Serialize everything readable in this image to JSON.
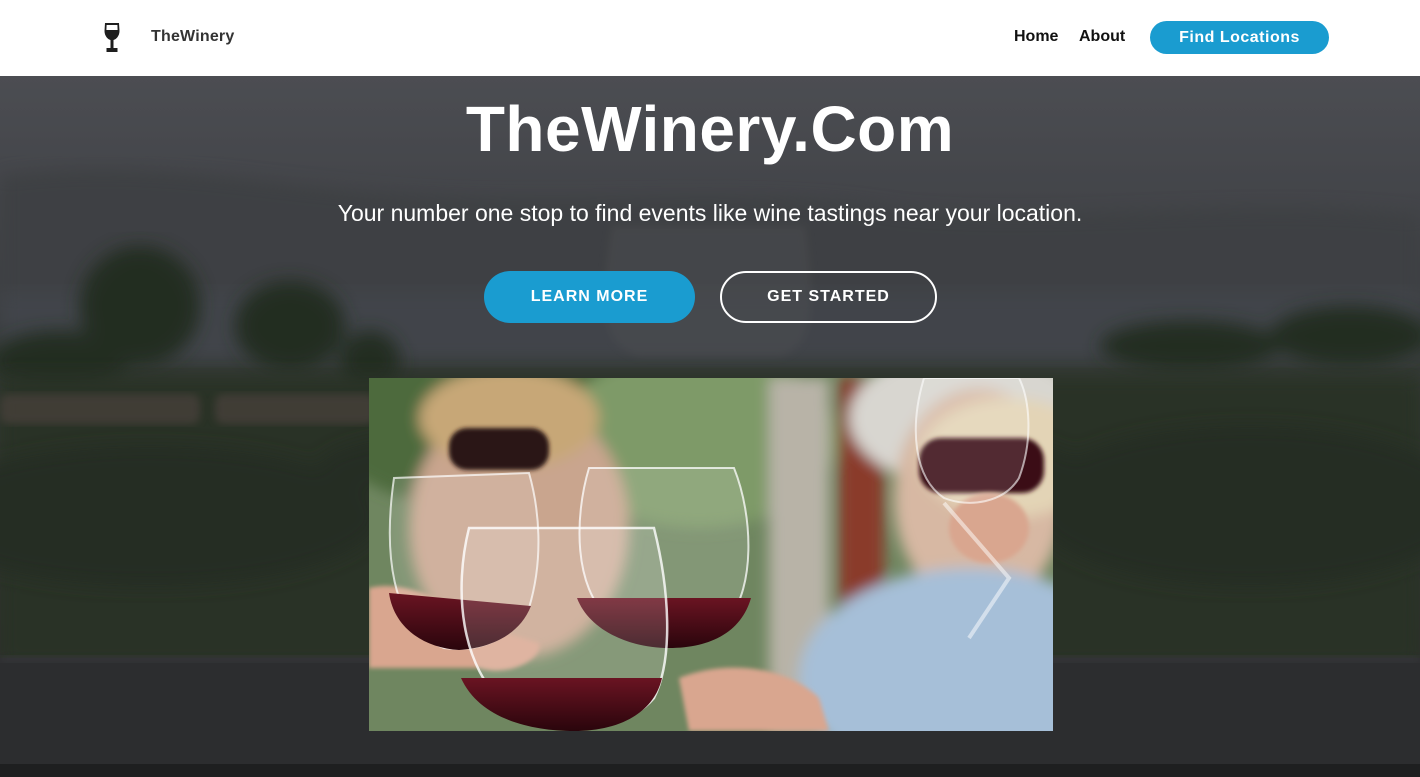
{
  "navbar": {
    "brand": "TheWinery",
    "brand_icon": "wine-glass-icon",
    "links": [
      "Home",
      "About"
    ],
    "cta": "Find Locations"
  },
  "hero": {
    "title": "TheWinery.Com",
    "subtitle": "Your number one stop to find events like wine tastings near your location.",
    "learn_more": "LEARN MORE",
    "get_started": "GET STARTED"
  },
  "colors": {
    "accent": "#1a9cd0",
    "navbar_bg": "#ffffff",
    "hero_overlay": "#2c2c2e"
  }
}
